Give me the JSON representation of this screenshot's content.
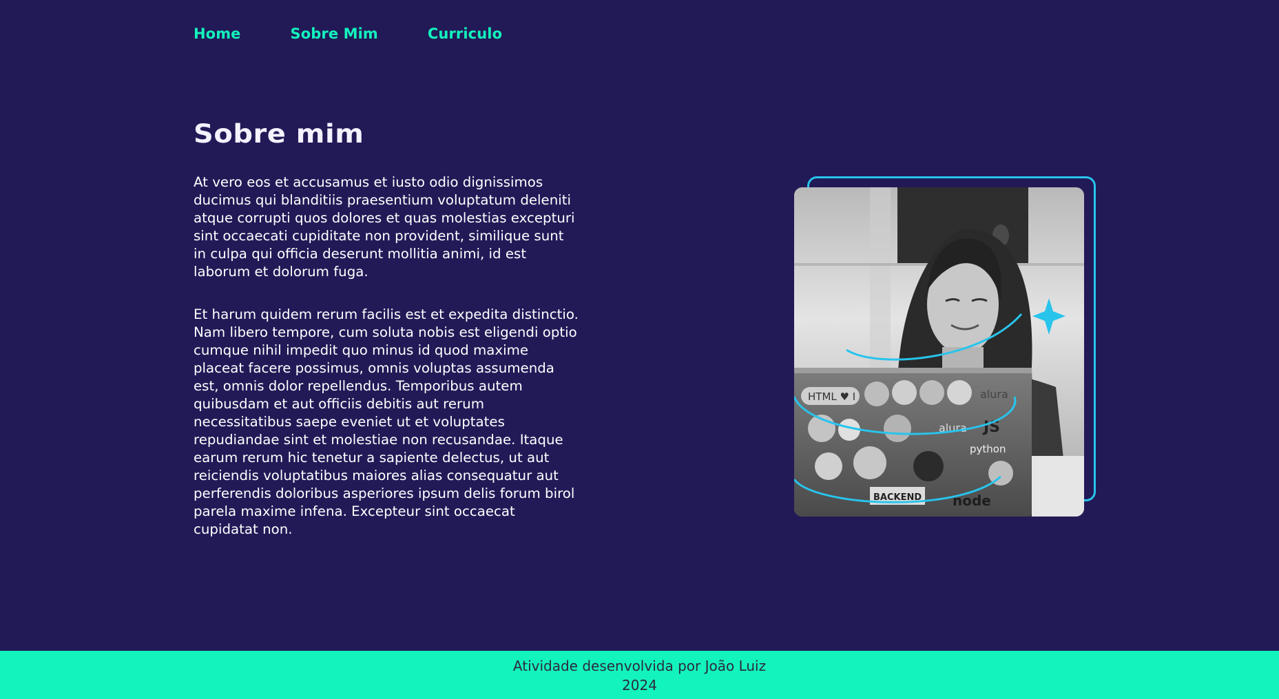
{
  "nav": {
    "items": [
      {
        "label": "Home"
      },
      {
        "label": "Sobre Mim"
      },
      {
        "label": "Curriculo"
      }
    ]
  },
  "main": {
    "title": "Sobre mim",
    "paragraphs": [
      "At vero eos et accusamus et iusto odio dignissimos ducimus qui blanditiis praesentium voluptatum deleniti atque corrupti quos dolores et quas molestias excepturi sint occaecati cupiditate non provident, similique sunt in culpa qui officia deserunt mollitia animi, id est laborum et dolorum fuga.",
      "Et harum quidem rerum facilis est et expedita distinctio. Nam libero tempore, cum soluta nobis est eligendi optio cumque nihil impedit quo minus id quod maxime placeat facere possimus, omnis voluptas assumenda est, omnis dolor repellendus. Temporibus autem quibusdam et aut officiis debitis aut rerum necessitatibus saepe eveniet ut et voluptates repudiandae sint et molestiae non recusandae. Itaque earum rerum hic tenetur a sapiente delectus, ut aut reiciendis voluptatibus maiores alias consequatur aut perferendis doloribus asperiores ipsum delis forum birol parela maxime infena. Excepteur sint occaecat cupidatat non."
    ]
  },
  "photo": {
    "icon": "profile-photo-woman-laptop",
    "sticker_text": [
      "HTML ♥ I",
      "alura",
      "JS",
      "alura",
      "python",
      "BACKEND",
      "node"
    ]
  },
  "footer": {
    "line1": "Atividade desenvolvida por João Luiz",
    "line2": "2024"
  },
  "colors": {
    "background": "#221a57",
    "accent": "#13f3bd",
    "frame": "#28c4ec",
    "footer_text": "#2b2b3a"
  }
}
